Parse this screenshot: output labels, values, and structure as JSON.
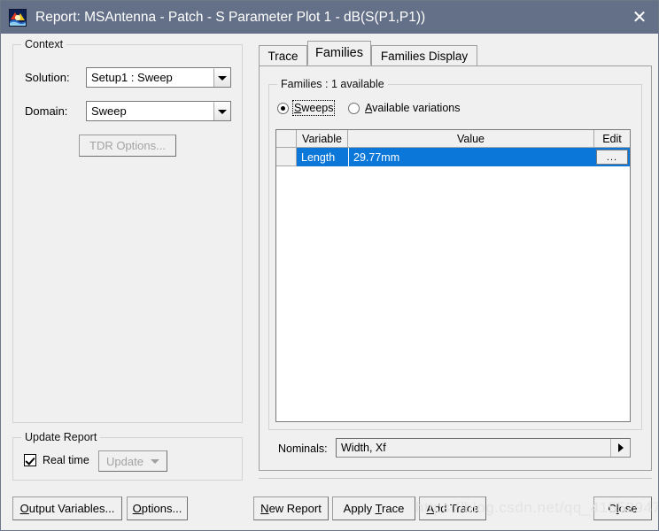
{
  "window": {
    "title": "Report: MSAntenna - Patch - S Parameter Plot 1 - dB(S(P1,P1))",
    "icon": "hfss-report-icon",
    "close_label": "✕",
    "titlebar_color": "#647087",
    "accent_color": "#0b77d9",
    "background_color": "#f0f0f0"
  },
  "context": {
    "group_title": "Context",
    "solution_label": "Solution:",
    "solution_value": "Setup1 : Sweep",
    "domain_label": "Domain:",
    "domain_value": "Sweep",
    "tdr_button": "TDR Options..."
  },
  "update_report": {
    "group_title": "Update Report",
    "realtime_label": "Real time",
    "realtime_checked": true,
    "update_button": "Update"
  },
  "left_buttons": {
    "output_variables": "Output Variables...",
    "options": "Options..."
  },
  "tabs": [
    {
      "label": "Trace",
      "active": false
    },
    {
      "label": "Families",
      "active": true
    },
    {
      "label": "Families Display",
      "active": false
    }
  ],
  "families": {
    "group_title": "Families : 1 available",
    "radios": [
      {
        "label": "Sweeps",
        "selected": true,
        "focused": true
      },
      {
        "label": "Available variations",
        "selected": false,
        "focused": false
      }
    ],
    "grid": {
      "columns": [
        "",
        "Variable",
        "Value",
        "Edit"
      ],
      "rows": [
        {
          "variable": "Length",
          "value": "29.77mm",
          "edit": "...",
          "selected": true
        }
      ]
    },
    "nominals_label": "Nominals:",
    "nominals_value": "Width, Xf"
  },
  "bottom_buttons": {
    "new_report": "New Report",
    "apply_trace": "Apply Trace",
    "add_trace": "Add Trace",
    "close": "Close"
  },
  "watermark": "https://blog.csdn.net/qq_41552947"
}
